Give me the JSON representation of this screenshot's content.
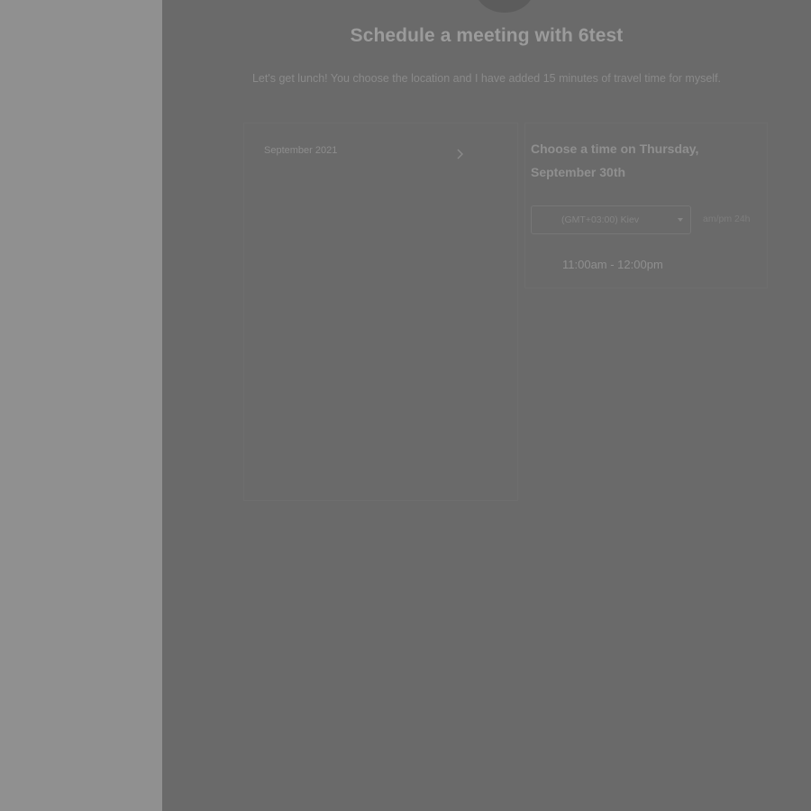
{
  "header": {
    "title": "Schedule a meeting with 6test",
    "description": "Let's get lunch! You choose the location and I have added 15 minutes of travel time for myself."
  },
  "calendar": {
    "month_label": "September 2021",
    "next_icon": "chevron-right-icon"
  },
  "times": {
    "heading": "Choose a time on Thursday, September 30th",
    "timezone_value": "(GMT+03:00) Kiev",
    "format_toggle_label": "am/pm  24h",
    "slots": [
      {
        "label": "11:00am - 12:00pm"
      }
    ]
  },
  "colors": {
    "page_overlay": "#6a6a6a",
    "side_panel": "#909090"
  }
}
